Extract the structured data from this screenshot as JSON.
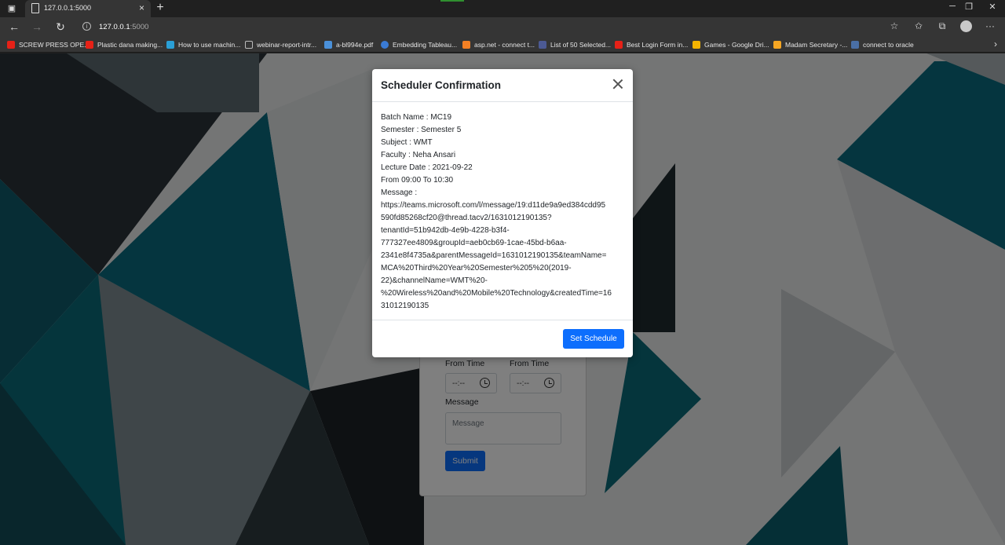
{
  "browser": {
    "tab_title": "127.0.0.1:5000",
    "url_host": "127.0.0.1",
    "url_port": ":5000",
    "bookmarks": [
      {
        "label": "SCREW PRESS OPE...",
        "icon_color": "#e62117"
      },
      {
        "label": "Plastic dana making...",
        "icon_color": "#e62117"
      },
      {
        "label": "How to use machin...",
        "icon_color": "#2a9fd6"
      },
      {
        "label": "webinar-report-intr...",
        "icon_color": "#bbbbbb"
      },
      {
        "label": "a-bl994e.pdf",
        "icon_color": "#4a90d9"
      },
      {
        "label": "Embedding Tableau...",
        "icon_color": "#3a7bd5"
      },
      {
        "label": "asp.net - connect t...",
        "icon_color": "#f48024"
      },
      {
        "label": "List of 50 Selected...",
        "icon_color": "#4c5a94"
      },
      {
        "label": "Best Login Form in...",
        "icon_color": "#e62117"
      },
      {
        "label": "Games - Google Dri...",
        "icon_color": "#f4b400"
      },
      {
        "label": "Madam Secretary -...",
        "icon_color": "#f5a623"
      },
      {
        "label": "connect to oracle",
        "icon_color": "#4a6fa5"
      }
    ]
  },
  "form": {
    "from_time_label_1": "From Time",
    "from_time_label_2": "From Time",
    "time_placeholder": "--:--",
    "message_label": "Message",
    "message_placeholder": "Message",
    "submit_label": "Submit"
  },
  "modal": {
    "title": "Scheduler Confirmation",
    "lines": {
      "batch": "Batch Name : MC19",
      "semester": "Semester : Semester 5",
      "subject": "Subject : WMT",
      "faculty": "Faculty : Neha Ansari",
      "date": "Lecture Date : 2021-09-22",
      "time": "From 09:00 To 10:30",
      "message_label": "Message :"
    },
    "message_lines": [
      "https://teams.microsoft.com/l/message/19:d11de9a9ed384cdd95",
      "590fd85268cf20@thread.tacv2/1631012190135?",
      "tenantId=51b942db-4e9b-4228-b3f4-",
      "777327ee4809&groupId=aeb0cb69-1cae-45bd-b6aa-",
      "2341e8f4735a&parentMessageId=1631012190135&teamName=",
      "MCA%20Third%20Year%20Semester%205%20(2019-",
      "22)&channelName=WMT%20-",
      "%20Wireless%20and%20Mobile%20Technology&createdTime=16",
      "31012190135"
    ],
    "button_label": "Set Schedule"
  },
  "colors": {
    "primary": "#0d6efd",
    "teal": "#0b6b7e",
    "dark": "#1c2326"
  }
}
